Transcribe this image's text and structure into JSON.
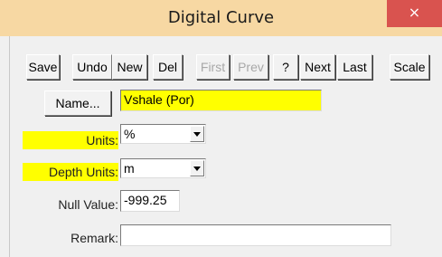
{
  "window": {
    "title": "Digital Curve",
    "close_glyph": "×"
  },
  "toolbar": {
    "save": "Save",
    "undo": "Undo",
    "new": "New",
    "del": "Del",
    "first": "First",
    "prev": "Prev",
    "help": "?",
    "next": "Next",
    "last": "Last",
    "scale": "Scale"
  },
  "form": {
    "name_button": "Name...",
    "name_value": "Vshale (Por)",
    "units_label": "Units:",
    "units_value": "%",
    "depth_units_label": "Depth Units:",
    "depth_units_value": "m",
    "null_value_label": "Null Value:",
    "null_value": "-999.25",
    "remark_label": "Remark:",
    "remark_value": ""
  },
  "colors": {
    "highlight": "#ffff00",
    "titlebar": "#f7d8a3",
    "close": "#d9534f"
  },
  "icons": {
    "close": "close-icon",
    "dropdown": "chevron-down-icon"
  }
}
